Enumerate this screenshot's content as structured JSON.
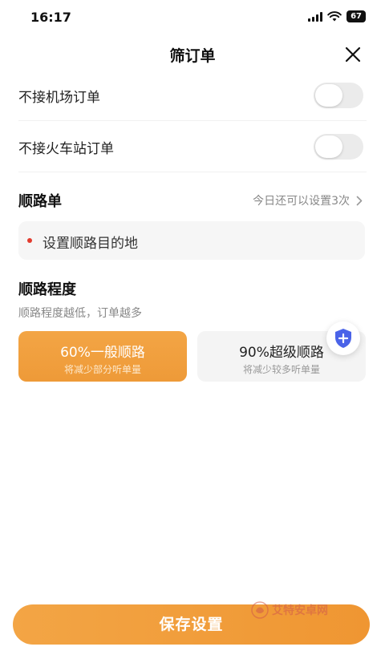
{
  "status_bar": {
    "time": "16:17",
    "battery": "67"
  },
  "header": {
    "title": "筛订单"
  },
  "filters": [
    {
      "label": "不接机场订单",
      "enabled": false
    },
    {
      "label": "不接火车站订单",
      "enabled": false
    }
  ],
  "route_order": {
    "title": "顺路单",
    "hint": "今日还可以设置3次",
    "destination_placeholder": "设置顺路目的地"
  },
  "route_level": {
    "title": "顺路程度",
    "hint": "顺路程度越低，订单越多",
    "options": [
      {
        "main": "60%一般顺路",
        "sub": "将减少部分听单量",
        "selected": true
      },
      {
        "main": "90%超级顺路",
        "sub": "将减少较多听单量",
        "selected": false
      }
    ]
  },
  "footer": {
    "save_label": "保存设置"
  },
  "watermark": {
    "text": "艾特安卓网"
  },
  "colors": {
    "accent": "#F0A03C",
    "toggle_off": "#EBEBEB",
    "dot": "#E23B2E",
    "shield": "#4A63E8"
  }
}
